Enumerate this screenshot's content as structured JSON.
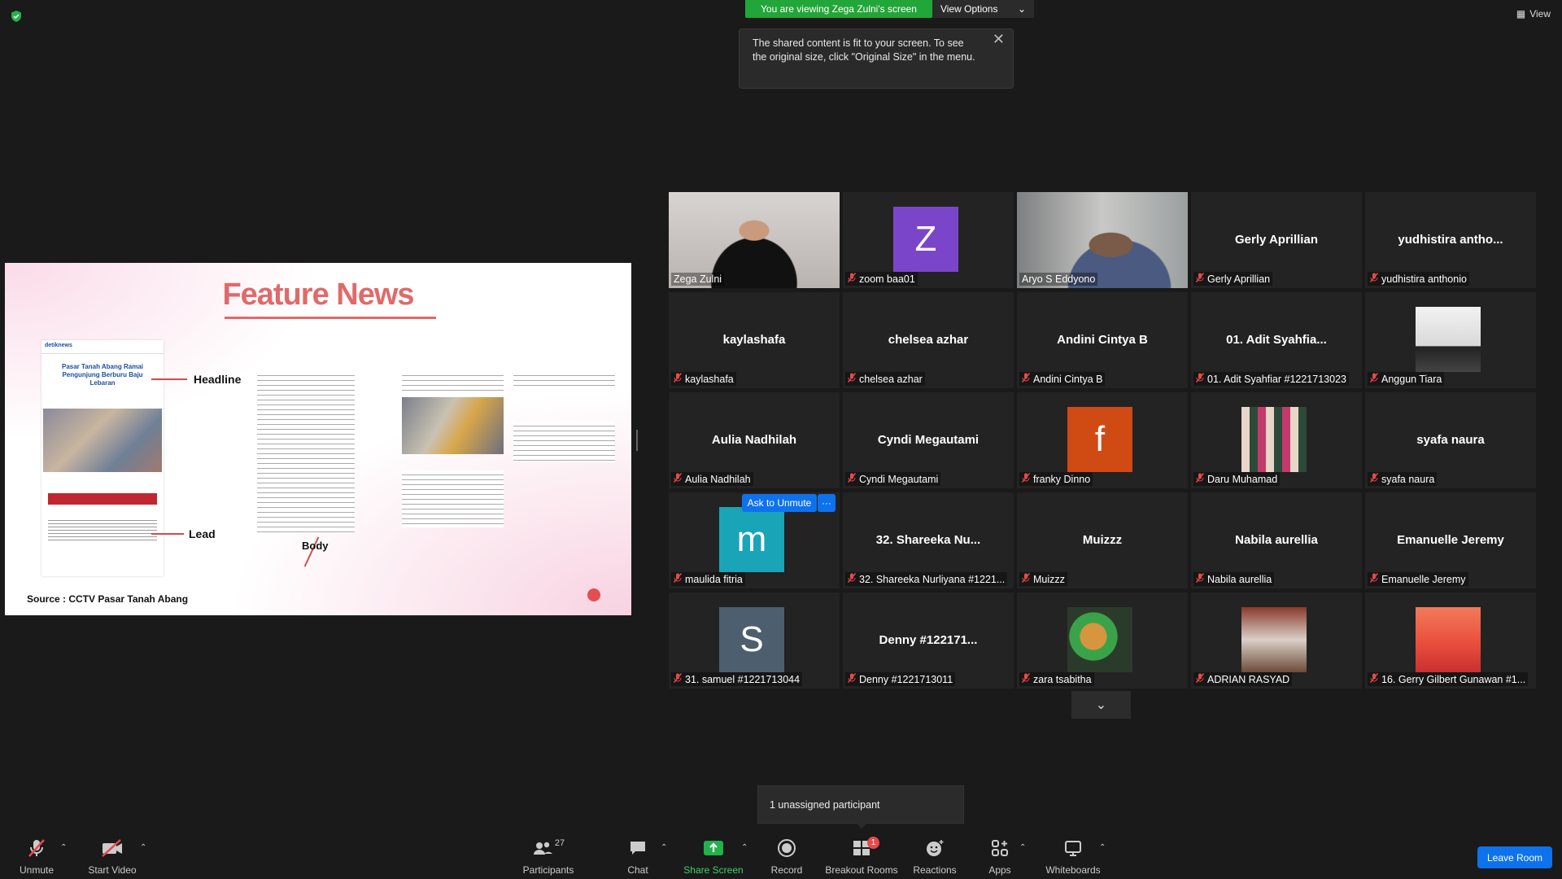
{
  "topbar": {
    "viewing_banner": "You are viewing Zega Zulni's screen",
    "view_options": "View Options",
    "view_label": "View"
  },
  "tooltip": {
    "text": "The shared content is fit to your screen. To see the original size, click \"Original Size\" in the menu."
  },
  "slide": {
    "title": "Feature News",
    "label_headline": "Headline",
    "label_lead": "Lead",
    "label_body": "Body",
    "source": "Source :  CCTV Pasar Tanah Abang",
    "article_title": "Pasar Tanah Abang Ramai Pengunjung Berburu Baju Lebaran",
    "brand": "detiknews"
  },
  "participants": [
    {
      "name": "Zega Zulni",
      "type": "video",
      "muted": false
    },
    {
      "name": "zoom baa01",
      "type": "avatar",
      "letter": "Z",
      "color": "#7b45c9",
      "muted": true
    },
    {
      "name": "Aryo S Eddyono",
      "type": "video",
      "muted": false,
      "active": true
    },
    {
      "name": "Gerly Aprillian",
      "type": "text",
      "display": "Gerly Aprillian",
      "muted": true
    },
    {
      "name": "yudhistira anthonio",
      "type": "text",
      "display": "yudhistira  antho...",
      "muted": true
    },
    {
      "name": "kaylashafa",
      "type": "text",
      "display": "kaylashafa",
      "muted": true
    },
    {
      "name": "chelsea azhar",
      "type": "text",
      "display": "chelsea azhar",
      "muted": true
    },
    {
      "name": "Andini Cintya B",
      "type": "text",
      "display": "Andini Cintya B",
      "muted": true
    },
    {
      "name": "01. Adit Syahfiar #1221713023",
      "type": "text",
      "display": "01.  Adit  Syahfia...",
      "muted": true
    },
    {
      "name": "Anggun Tiara",
      "type": "photo",
      "muted": true
    },
    {
      "name": "Aulia Nadhilah",
      "type": "text",
      "display": "Aulia Nadhilah",
      "muted": true
    },
    {
      "name": "Cyndi Megautami",
      "type": "text",
      "display": "Cyndi Megautami",
      "muted": true
    },
    {
      "name": "franky Dinno",
      "type": "avatar",
      "letter": "f",
      "color": "#d04a14",
      "muted": true
    },
    {
      "name": "Daru Muhamad",
      "type": "photo",
      "muted": true
    },
    {
      "name": "syafa naura",
      "type": "text",
      "display": "syafa naura",
      "muted": true
    },
    {
      "name": "maulida fitria",
      "type": "avatar",
      "letter": "m",
      "color": "#1aa4b8",
      "muted": true
    },
    {
      "name": "32. Shareeka Nurliyana #1221...",
      "type": "text",
      "display": "32.  Shareeka  Nu...",
      "muted": true
    },
    {
      "name": "Muizzz",
      "type": "text",
      "display": "Muizzz",
      "muted": true
    },
    {
      "name": "Nabila aurellia",
      "type": "text",
      "display": "Nabila aurellia",
      "muted": true
    },
    {
      "name": "Emanuelle Jeremy",
      "type": "text",
      "display": "Emanuelle Jeremy",
      "muted": true
    },
    {
      "name": "31. samuel #1221713044",
      "type": "avatar",
      "letter": "S",
      "color": "#4d5f6e",
      "muted": true
    },
    {
      "name": "Denny #1221713011",
      "type": "text",
      "display": "Denny  #122171...",
      "muted": true
    },
    {
      "name": "zara tsabitha",
      "type": "photo",
      "muted": true
    },
    {
      "name": "ADRIAN RASYAD",
      "type": "photo",
      "muted": true
    },
    {
      "name": "16. Gerry Gilbert Gunawan #1...",
      "type": "photo",
      "muted": true
    }
  ],
  "ask_unmute": "Ask to Unmute",
  "more_dots": "···",
  "unassigned": "1 unassigned participant",
  "toolbar": {
    "unmute": "Unmute",
    "start_video": "Start Video",
    "participants": "Participants",
    "participants_count": "27",
    "chat": "Chat",
    "share_screen": "Share Screen",
    "record": "Record",
    "breakout_rooms": "Breakout Rooms",
    "breakout_badge": "1",
    "reactions": "Reactions",
    "apps": "Apps",
    "whiteboards": "Whiteboards",
    "leave_room": "Leave Room"
  },
  "colors": {
    "accent_blue": "#0e72ed",
    "viewing_green": "#22a639",
    "active_speaker": "#c8e85a",
    "slide_title": "#e06a6a"
  }
}
